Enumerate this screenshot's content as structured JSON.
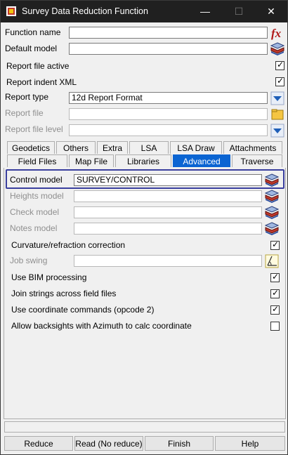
{
  "window": {
    "title": "Survey Data Reduction Function",
    "controls": {
      "minimize": "—",
      "maximize": "☐",
      "close": "✕"
    }
  },
  "top_fields": {
    "function_name": {
      "label": "Function name",
      "value": ""
    },
    "default_model": {
      "label": "Default model",
      "value": ""
    },
    "report_file_active": {
      "label": "Report file active",
      "checked": true
    },
    "report_indent_xml": {
      "label": "Report indent XML",
      "checked": true
    },
    "report_type": {
      "label": "Report type",
      "value": "12d Report Format"
    },
    "report_file": {
      "label": "Report file",
      "value": ""
    },
    "report_file_level": {
      "label": "Report file level",
      "value": ""
    }
  },
  "tabs_row1": [
    "Geodetics",
    "Others",
    "Extra",
    "LSA",
    "LSA Draw",
    "Attachments"
  ],
  "tabs_row2": [
    "Field Files",
    "Map File",
    "Libraries",
    "Advanced",
    "Traverse"
  ],
  "active_tab": "Advanced",
  "advanced": {
    "control_model": {
      "label": "Control model",
      "value": "SURVEY/CONTROL"
    },
    "heights_model": {
      "label": "Heights model",
      "value": ""
    },
    "check_model": {
      "label": "Check model",
      "value": ""
    },
    "notes_model": {
      "label": "Notes model",
      "value": ""
    },
    "curvature": {
      "label": "Curvature/refraction correction",
      "checked": true
    },
    "job_swing": {
      "label": "Job swing",
      "value": ""
    },
    "use_bim": {
      "label": "Use BIM processing",
      "checked": true
    },
    "join_strings": {
      "label": "Join strings across field files",
      "checked": true
    },
    "use_coord": {
      "label": "Use coordinate commands (opcode 2)",
      "checked": true
    },
    "allow_backsights": {
      "label": "Allow backsights with Azimuth to calc coordinate",
      "checked": false
    }
  },
  "status_text": "",
  "buttons": {
    "reduce": "Reduce",
    "read": "Read (No reduce)",
    "finish": "Finish",
    "help": "Help"
  },
  "icons": {
    "app": "12d-app-icon",
    "fx": "fx-function-icon",
    "model": "model-layers-icon",
    "dropdown": "chevron-down-icon",
    "folder": "folder-icon",
    "angle": "angle-picker-icon"
  },
  "colors": {
    "accent": "#0a64d2",
    "highlight_border": "#3a3f9e",
    "titlebar": "#202020"
  }
}
